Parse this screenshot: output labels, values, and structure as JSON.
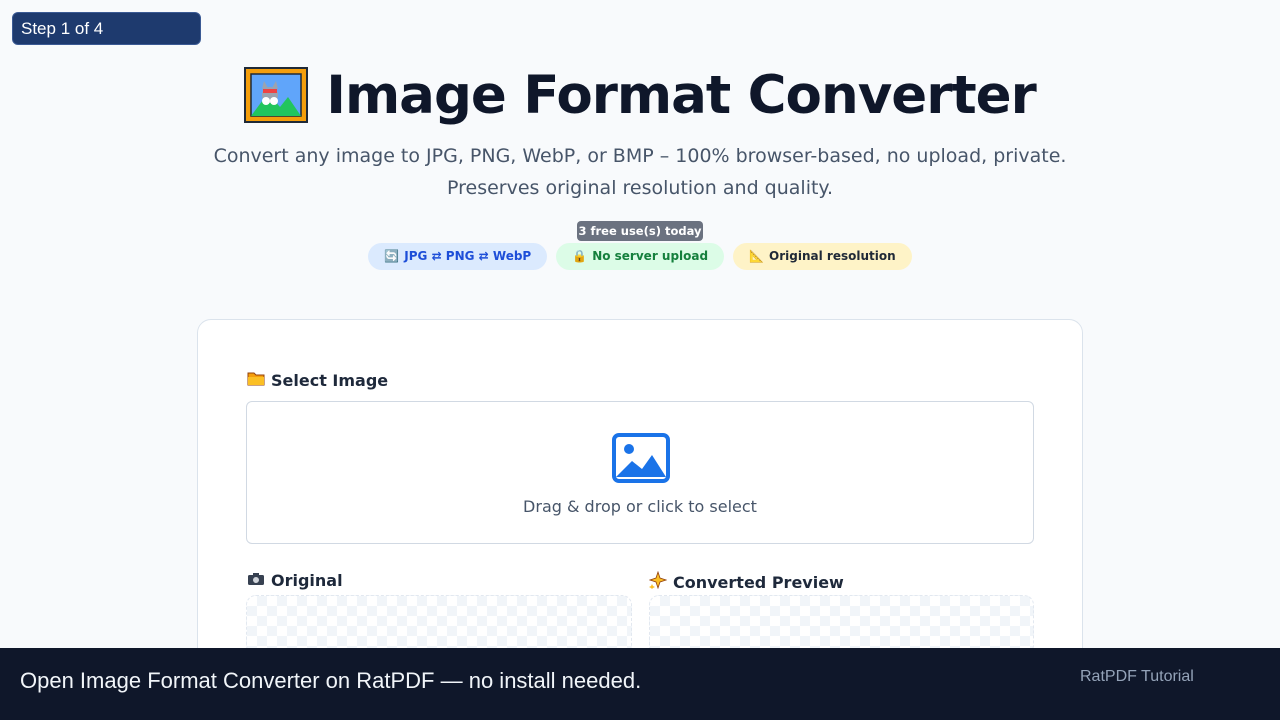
{
  "step_badge": "Step 1 of 4",
  "hero": {
    "icon": "framed-picture-icon",
    "title": "Image Format Converter",
    "subtitle_line1": "Convert any image to JPG, PNG, WebP, or BMP – 100% browser-based, no upload, private.",
    "subtitle_line2": "Preserves original resolution and quality."
  },
  "usage_badge": "3 free use(s) today",
  "features": [
    {
      "emoji": "🔄",
      "label": "JPG ⇄ PNG ⇄ WebP",
      "icon": "arrows-cycle-icon"
    },
    {
      "emoji": "🔒",
      "label": "No server upload",
      "icon": "lock-icon"
    },
    {
      "emoji": "📐",
      "label": "Original resolution",
      "icon": "triangle-ruler-icon"
    }
  ],
  "converter": {
    "select_label": "Select Image",
    "select_icon": "folder-icon",
    "dropzone_text": "Drag & drop or click to select",
    "dropzone_icon": "image-icon",
    "original_label": "Original",
    "original_icon": "camera-icon",
    "converted_label": "Converted Preview",
    "converted_icon": "sparkles-icon"
  },
  "footer": {
    "caption": "Open Image Format Converter on RatPDF — no install needed.",
    "brand": "RatPDF Tutorial"
  },
  "colors": {
    "accent": "#1a73e8",
    "footer_bg": "#0f172a",
    "step_badge_bg": "#1e3a6e"
  }
}
